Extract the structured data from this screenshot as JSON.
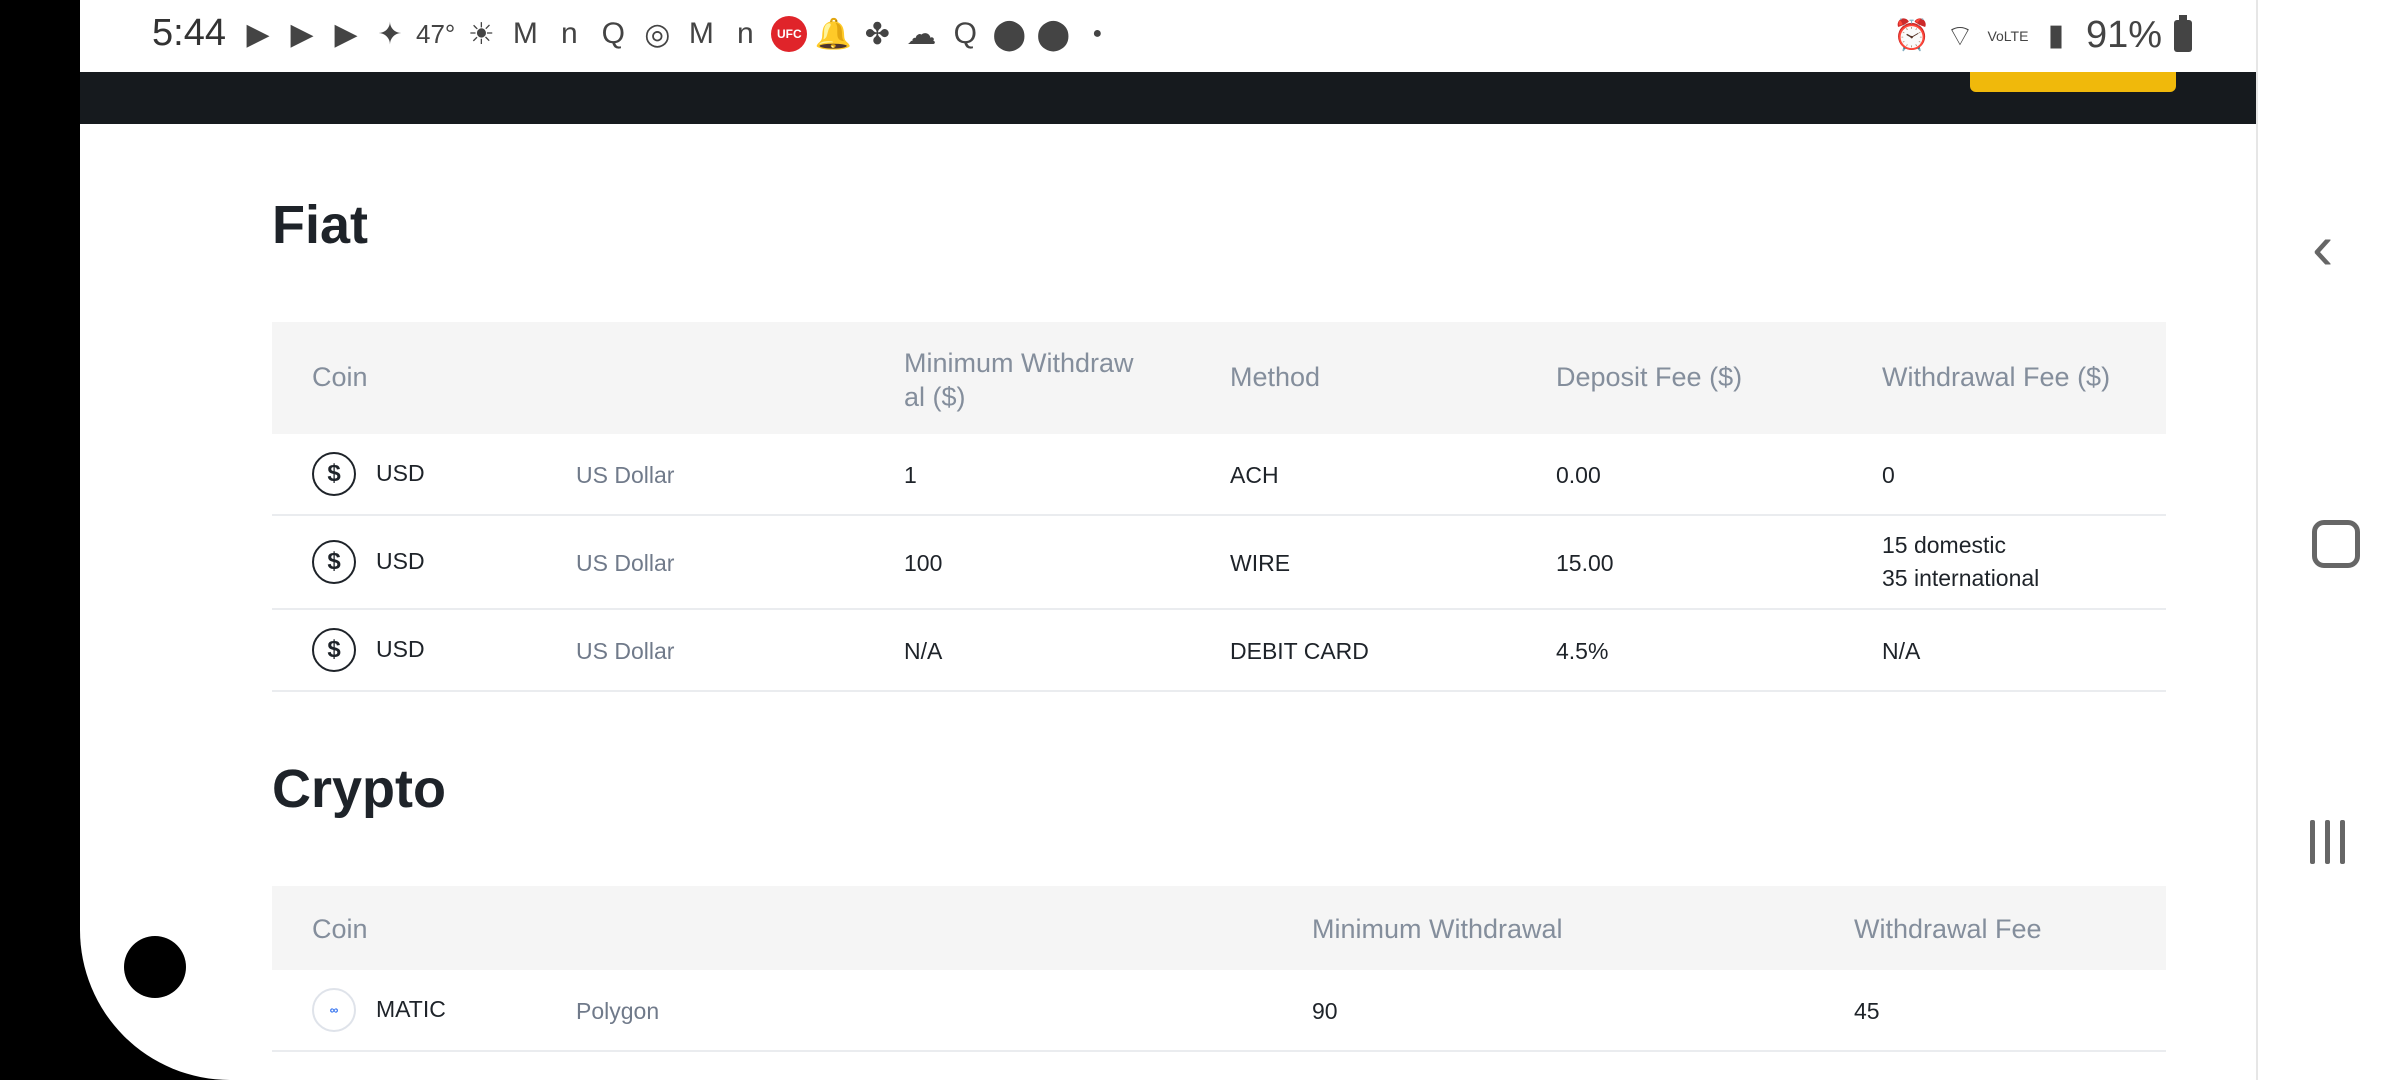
{
  "status_bar": {
    "time": "5:44",
    "temperature": "47°",
    "battery": "91%",
    "left_icons": [
      "youtube-icon",
      "youtube-icon",
      "youtube-icon",
      "twitter-icon",
      "weather-icon",
      "gmail-icon",
      "n-app-icon",
      "q-app-icon",
      "instagram-icon",
      "gmail-icon",
      "n-app-icon",
      "ufc-icon",
      "bell-icon",
      "fan-icon",
      "cloud-icon",
      "q-app-icon",
      "location-icon",
      "location-icon",
      "dot-icon"
    ],
    "right_icons": [
      "alarm-icon",
      "wifi-icon",
      "volte-icon",
      "signal-icon",
      "battery-icon"
    ],
    "ufc_label": "UFC"
  },
  "fiat": {
    "title": "Fiat",
    "headers": {
      "coin": "Coin",
      "min_withdrawal": "Minimum Withdraw\nal ($)",
      "method": "Method",
      "deposit_fee": "Deposit Fee ($)",
      "withdrawal_fee": "Withdrawal Fee ($)"
    },
    "rows": [
      {
        "symbol": "USD",
        "name": "US Dollar",
        "min": "1",
        "method": "ACH",
        "deposit": "0.00",
        "withdrawal_1": "0",
        "withdrawal_2": ""
      },
      {
        "symbol": "USD",
        "name": "US Dollar",
        "min": "100",
        "method": "WIRE",
        "deposit": "15.00",
        "withdrawal_1": "15 domestic",
        "withdrawal_2": "35 international"
      },
      {
        "symbol": "USD",
        "name": "US Dollar",
        "min": "N/A",
        "method": "DEBIT CARD",
        "deposit": "4.5%",
        "withdrawal_1": "N/A",
        "withdrawal_2": ""
      }
    ]
  },
  "crypto": {
    "title": "Crypto",
    "headers": {
      "coin": "Coin",
      "min_withdrawal": "Minimum Withdrawal",
      "withdrawal_fee": "Withdrawal Fee"
    },
    "rows": [
      {
        "symbol": "MATIC",
        "name": "Polygon",
        "min": "90",
        "fee": "45"
      }
    ]
  },
  "colors": {
    "accent": "#f0b90b",
    "nav_dark": "#161a1e",
    "header_bg": "#f5f5f5",
    "text_primary": "#1e2329",
    "text_muted": "#848e9c"
  }
}
